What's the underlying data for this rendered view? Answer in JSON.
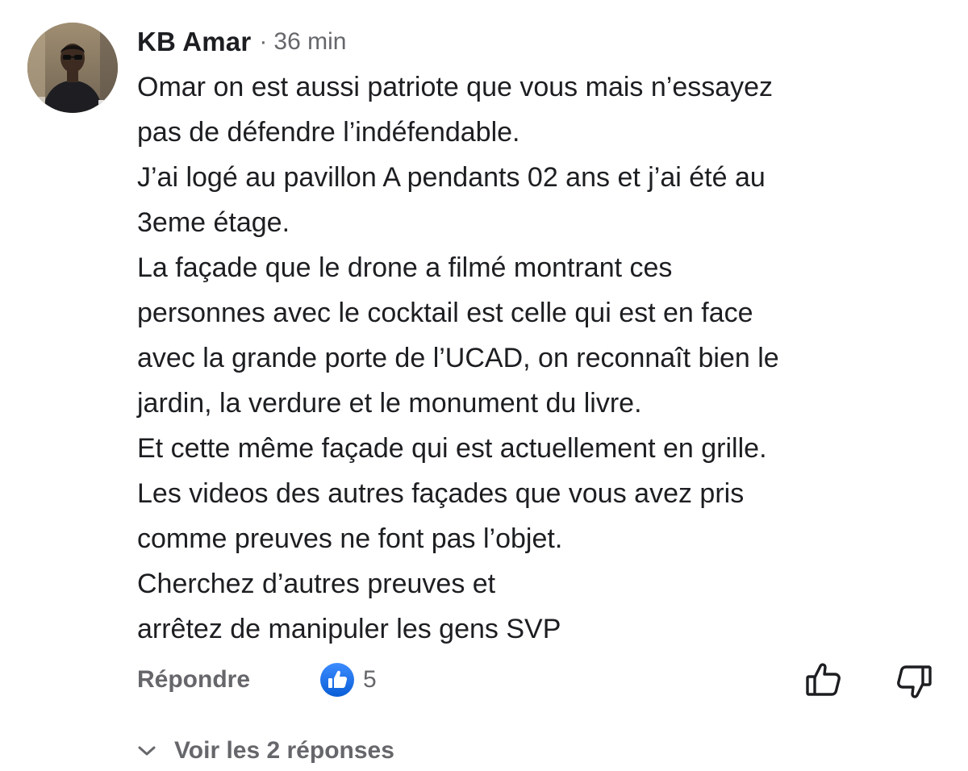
{
  "comment": {
    "author": "KB Amar",
    "separator": "·",
    "time": "36 min",
    "lines": [
      "Omar on est aussi patriote que vous mais n’essayez",
      "pas de défendre l’indéfendable.",
      "J’ai logé au pavillon A pendants 02 ans et j’ai été au",
      "3eme étage.",
      "La façade que le drone a filmé montrant ces",
      "personnes avec le cocktail est celle qui est en face",
      "avec la grande porte de l’UCAD, on reconnaît bien le",
      "jardin, la verdure et le monument du livre.",
      "Et cette même façade qui est actuellement en grille.",
      "Les videos des autres façades que vous avez pris",
      "comme preuves ne font pas l’objet.",
      "Cherchez d’autres preuves et",
      "arrêtez de manipuler les gens SVP"
    ]
  },
  "actions": {
    "reply_label": "Répondre",
    "like_count": "5",
    "like_icon": "like-badge-icon",
    "thumb_up_icon": "thumb-up-icon",
    "thumb_down_icon": "thumb-down-icon"
  },
  "replies": {
    "label": "Voir les 2 réponses",
    "icon": "chevron-down-icon"
  },
  "colors": {
    "text": "#1c1e21",
    "secondary": "#65676b",
    "like_blue": "#1877f2"
  }
}
